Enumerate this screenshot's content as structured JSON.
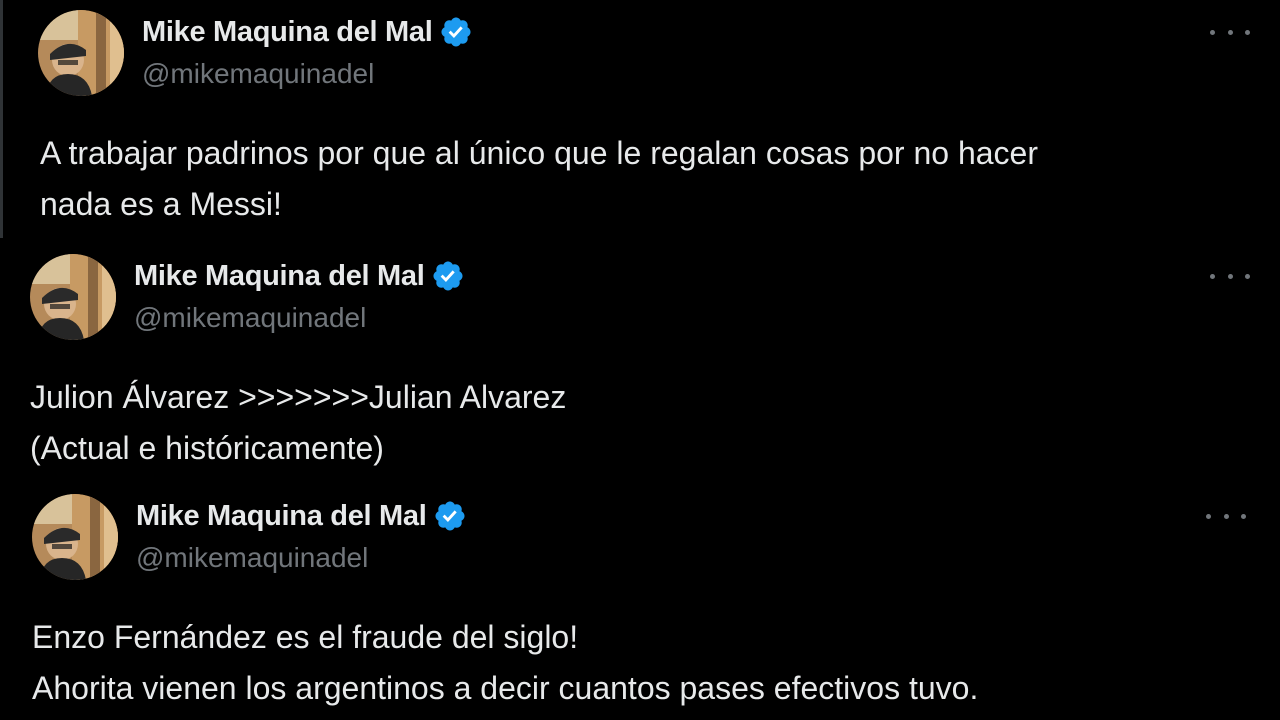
{
  "tweets": [
    {
      "author": {
        "display_name": "Mike Maquina del Mal",
        "handle": "@mikemaquinadel",
        "verified": true,
        "avatar_icon": "user-avatar"
      },
      "more_icon": "ellipsis-icon",
      "text_lines": [
        "A trabajar padrinos por que al único que le regalan cosas por no hacer",
        "nada es a Messi!"
      ]
    },
    {
      "author": {
        "display_name": "Mike Maquina del Mal",
        "handle": "@mikemaquinadel",
        "verified": true,
        "avatar_icon": "user-avatar"
      },
      "more_icon": "ellipsis-icon",
      "text_lines": [
        "Julion Álvarez >>>>>>>Julian Alvarez",
        "(Actual e históricamente)"
      ]
    },
    {
      "author": {
        "display_name": "Mike Maquina del Mal",
        "handle": "@mikemaquinadel",
        "verified": true,
        "avatar_icon": "user-avatar"
      },
      "more_icon": "ellipsis-icon",
      "text_lines": [
        "Enzo Fernández es el fraude del siglo!",
        "Ahorita vienen los argentinos a decir cuantos pases efectivos tuvo."
      ]
    }
  ],
  "colors": {
    "background": "#000000",
    "text_primary": "#e7e9ea",
    "text_secondary": "#71767b",
    "verified_badge": "#1d9bf0"
  }
}
